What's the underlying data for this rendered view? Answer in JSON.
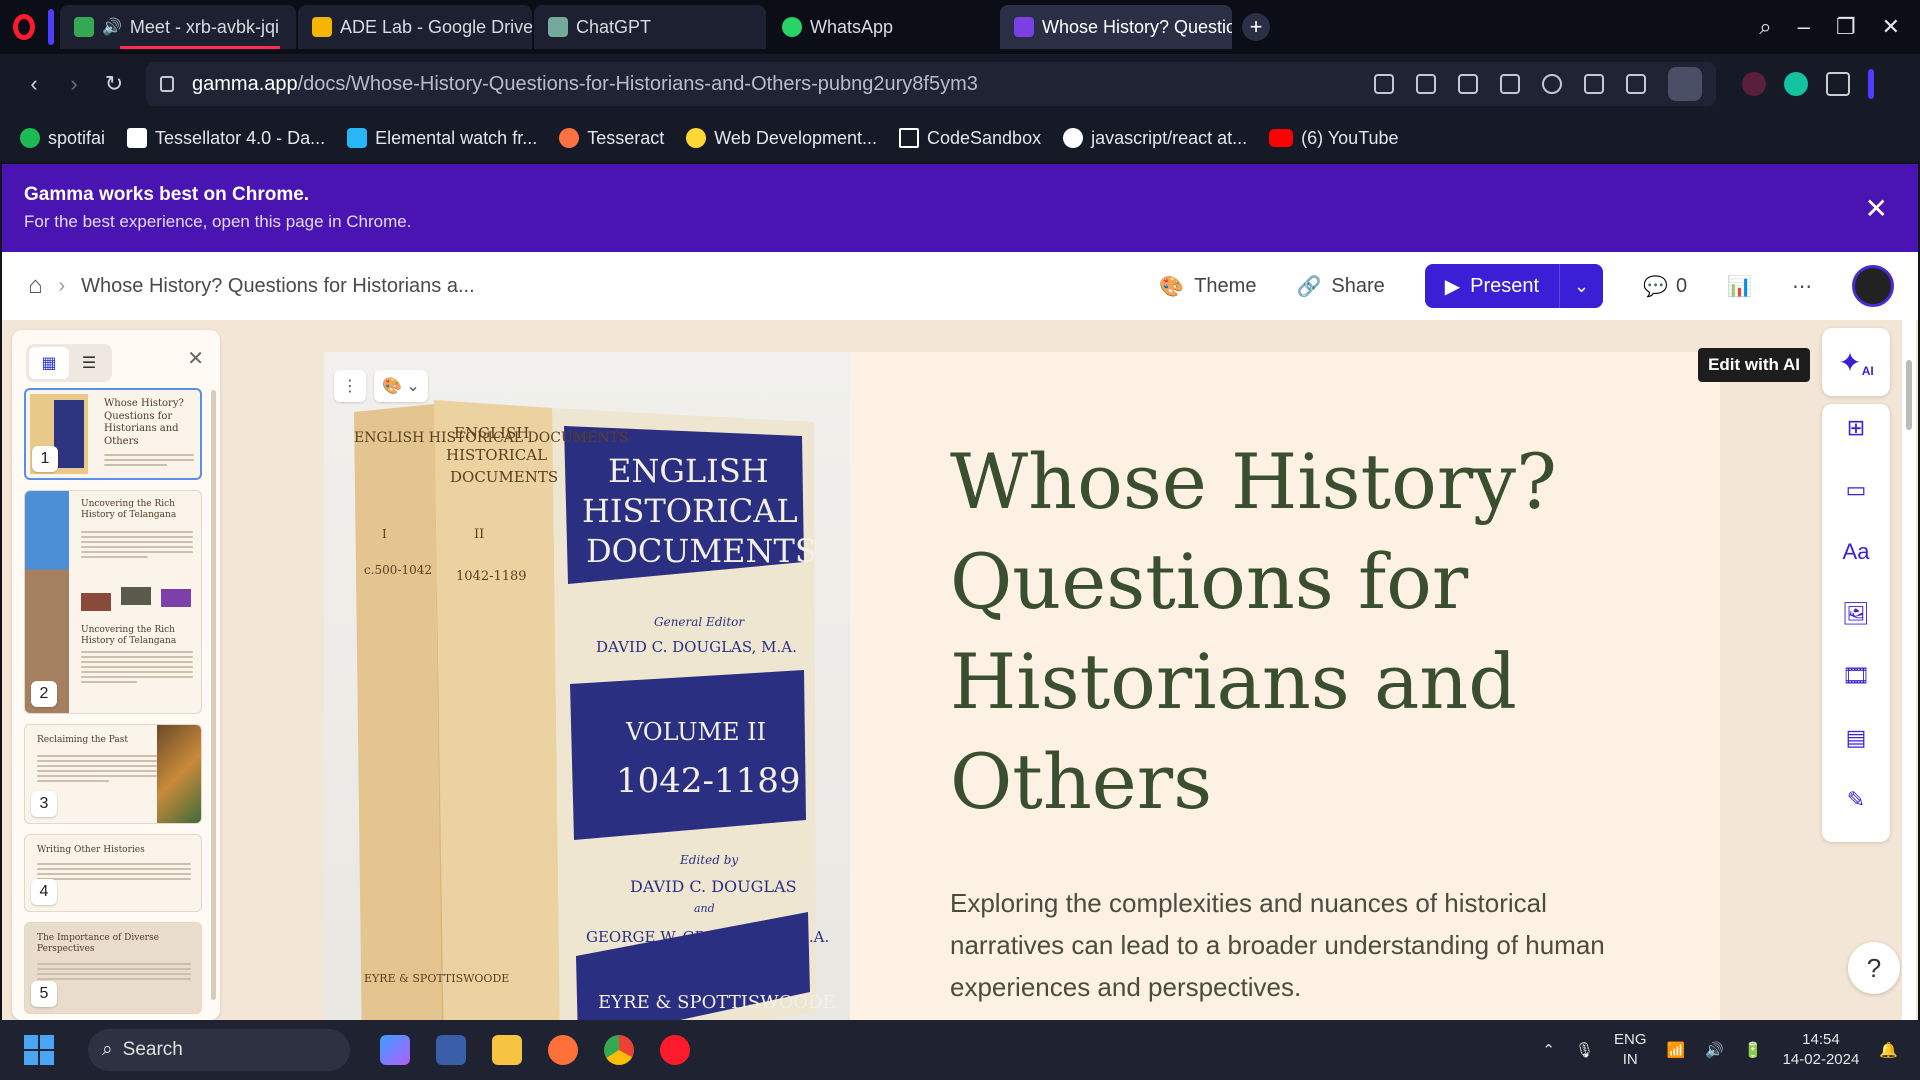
{
  "browser": {
    "tabs": [
      {
        "label": "Meet - xrb-avbk-jqi",
        "favicon_color": "#34a853",
        "active": false
      },
      {
        "label": "ADE Lab - Google Drive",
        "favicon_color": "#f4b400",
        "active": false
      },
      {
        "label": "ChatGPT",
        "favicon_color": "#74aa9c",
        "active": false
      },
      {
        "label": "WhatsApp",
        "favicon_color": "#25d366",
        "active": false
      },
      {
        "label": "Whose History? Questio",
        "favicon_color": "#7b3fe4",
        "active": true
      }
    ],
    "url_host": "gamma.app",
    "url_path": "/docs/Whose-History-Questions-for-Historians-and-Others-pubng2ury8f5ym3",
    "bookmarks": [
      {
        "label": "spotifai",
        "color": "#1db954"
      },
      {
        "label": "Tessellator 4.0 - Da...",
        "color": "#ffffff"
      },
      {
        "label": "Elemental watch fr...",
        "color": "#29b6f6"
      },
      {
        "label": "Tesseract",
        "color": "#ff7043"
      },
      {
        "label": "Web Development...",
        "color": "#fdd835"
      },
      {
        "label": "CodeSandbox",
        "color": "#ffffff"
      },
      {
        "label": "javascript/react at...",
        "color": "#ffffff"
      },
      {
        "label": "(6) YouTube",
        "color": "#ff0000"
      }
    ]
  },
  "banner": {
    "title": "Gamma works best on Chrome.",
    "subtitle": "For the best experience, open this page in Chrome.",
    "close_icon": "✕"
  },
  "appbar": {
    "doc_title": "Whose History? Questions for Historians a...",
    "theme_label": "Theme",
    "share_label": "Share",
    "present_label": "Present",
    "comment_count": "0"
  },
  "sidebar": {
    "slides": [
      {
        "number": "1",
        "title": "Whose History? Questions for Historians and Others"
      },
      {
        "number": "2",
        "title": "Uncovering the Rich History of Telangana"
      },
      {
        "number": "3",
        "title": "Reclaiming the Past"
      },
      {
        "number": "4",
        "title": "Writing Other Histories"
      },
      {
        "number": "5",
        "title": "The Importance of Diverse Perspectives"
      }
    ]
  },
  "card": {
    "title": "Whose History? Questions for Historians and Others",
    "description": "Exploring the complexities and nuances of historical narratives can lead to a broader understanding of human experiences and perspectives.",
    "book_cover": {
      "spine1_title": "ENGLISH HISTORICAL DOCUMENTS",
      "spine1_vol": "I",
      "spine1_years": "c.500-1042",
      "spine2_title": "ENGLISH HISTORICAL DOCUMENTS",
      "spine2_vol": "II",
      "spine2_years": "1042-1189",
      "cover_title": "ENGLISH HISTORICAL DOCUMENTS",
      "general_editor_label": "General Editor",
      "general_editor": "DAVID C. DOUGLAS, M.A.",
      "volume": "VOLUME II",
      "years": "1042-1189",
      "edited_by": "Edited by",
      "editor1": "DAVID C. DOUGLAS",
      "and": "and",
      "editor2": "GEORGE W. GREENAWAY, M.A.",
      "publisher": "EYRE & SPOTTISWOODE",
      "spine_publisher": "EYRE & SPOTTISWOODE"
    }
  },
  "rail": {
    "tooltip": "Edit with AI",
    "ai_badge": "AI",
    "help": "?"
  },
  "taskbar": {
    "search_label": "Search",
    "lang_top": "ENG",
    "lang_bottom": "IN",
    "time": "14:54",
    "date": "14-02-2024"
  }
}
